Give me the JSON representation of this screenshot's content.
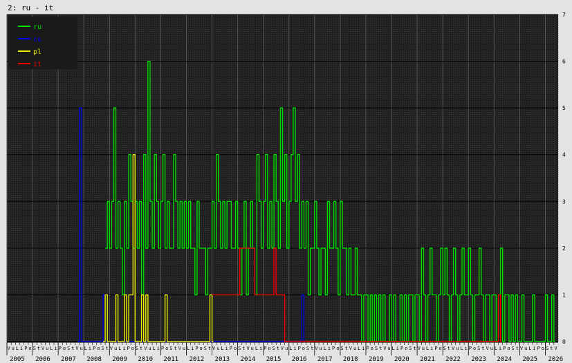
{
  "chart_data": {
    "type": "line",
    "title": "2: ru - it",
    "ylim": [
      0,
      7
    ],
    "y_ticks": [
      0,
      1,
      2,
      3,
      4,
      5,
      6,
      7
    ],
    "x_range": [
      "2005-01",
      "2026-07"
    ],
    "year_labels": [
      "2005",
      "2006",
      "2007",
      "2008",
      "2009",
      "2010",
      "2011",
      "2012",
      "2013",
      "2014",
      "2015",
      "2016",
      "2017",
      "2018",
      "2019",
      "2020",
      "2021",
      "2022",
      "2023",
      "2024",
      "2025",
      "2026"
    ],
    "month_labels": [
      "L",
      "i",
      "P",
      "o",
      "S",
      "t",
      "V",
      "u"
    ],
    "legend_position": "top-left",
    "background": "#202020",
    "grid": true,
    "series": [
      {
        "name": "ru",
        "color": "#00dd00",
        "points": [
          [
            "2008-11",
            2
          ],
          [
            "2008-12",
            3
          ],
          [
            "2009-01",
            2
          ],
          [
            "2009-02",
            3
          ],
          [
            "2009-03",
            5
          ],
          [
            "2009-04",
            2
          ],
          [
            "2009-05",
            3
          ],
          [
            "2009-06",
            2
          ],
          [
            "2009-07",
            1
          ],
          [
            "2009-08",
            3
          ],
          [
            "2009-09",
            2
          ],
          [
            "2009-10",
            4
          ],
          [
            "2009-11",
            3
          ],
          [
            "2009-12",
            2
          ],
          [
            "2010-01",
            3
          ],
          [
            "2010-02",
            2
          ],
          [
            "2010-03",
            3
          ],
          [
            "2010-04",
            1
          ],
          [
            "2010-05",
            4
          ],
          [
            "2010-06",
            2
          ],
          [
            "2010-07",
            6
          ],
          [
            "2010-08",
            3
          ],
          [
            "2010-09",
            2
          ],
          [
            "2010-10",
            4
          ],
          [
            "2010-11",
            3
          ],
          [
            "2010-12",
            2
          ],
          [
            "2011-01",
            3
          ],
          [
            "2011-02",
            4
          ],
          [
            "2011-03",
            2
          ],
          [
            "2011-04",
            3
          ],
          [
            "2011-05",
            2
          ],
          [
            "2011-06",
            2
          ],
          [
            "2011-07",
            4
          ],
          [
            "2011-08",
            3
          ],
          [
            "2011-09",
            2
          ],
          [
            "2011-10",
            3
          ],
          [
            "2011-11",
            2
          ],
          [
            "2011-12",
            3
          ],
          [
            "2012-01",
            2
          ],
          [
            "2012-02",
            3
          ],
          [
            "2012-03",
            2
          ],
          [
            "2012-04",
            2
          ],
          [
            "2012-05",
            1
          ],
          [
            "2012-06",
            3
          ],
          [
            "2012-07",
            2
          ],
          [
            "2012-08",
            2
          ],
          [
            "2012-09",
            2
          ],
          [
            "2012-10",
            1
          ],
          [
            "2012-11",
            2
          ],
          [
            "2012-12",
            2
          ],
          [
            "2013-01",
            3
          ],
          [
            "2013-02",
            2
          ],
          [
            "2013-03",
            4
          ],
          [
            "2013-04",
            3
          ],
          [
            "2013-05",
            2
          ],
          [
            "2013-06",
            3
          ],
          [
            "2013-07",
            2
          ],
          [
            "2013-08",
            3
          ],
          [
            "2013-09",
            3
          ],
          [
            "2013-10",
            2
          ],
          [
            "2013-11",
            2
          ],
          [
            "2013-12",
            3
          ],
          [
            "2014-01",
            2
          ],
          [
            "2014-02",
            1
          ],
          [
            "2014-03",
            2
          ],
          [
            "2014-04",
            3
          ],
          [
            "2014-05",
            1
          ],
          [
            "2014-06",
            2
          ],
          [
            "2014-07",
            3
          ],
          [
            "2014-08",
            2
          ],
          [
            "2014-09",
            1
          ],
          [
            "2014-10",
            4
          ],
          [
            "2014-11",
            3
          ],
          [
            "2014-12",
            2
          ],
          [
            "2015-01",
            3
          ],
          [
            "2015-02",
            4
          ],
          [
            "2015-03",
            2
          ],
          [
            "2015-04",
            3
          ],
          [
            "2015-05",
            2
          ],
          [
            "2015-06",
            4
          ],
          [
            "2015-07",
            3
          ],
          [
            "2015-08",
            2
          ],
          [
            "2015-09",
            5
          ],
          [
            "2015-10",
            3
          ],
          [
            "2015-11",
            4
          ],
          [
            "2015-12",
            2
          ],
          [
            "2016-01",
            3
          ],
          [
            "2016-02",
            4
          ],
          [
            "2016-03",
            5
          ],
          [
            "2016-04",
            3
          ],
          [
            "2016-05",
            4
          ],
          [
            "2016-06",
            2
          ],
          [
            "2016-07",
            3
          ],
          [
            "2016-08",
            2
          ],
          [
            "2016-09",
            3
          ],
          [
            "2016-10",
            1
          ],
          [
            "2016-11",
            2
          ],
          [
            "2016-12",
            2
          ],
          [
            "2017-01",
            3
          ],
          [
            "2017-02",
            2
          ],
          [
            "2017-03",
            1
          ],
          [
            "2017-04",
            2
          ],
          [
            "2017-05",
            2
          ],
          [
            "2017-06",
            1
          ],
          [
            "2017-07",
            3
          ],
          [
            "2017-08",
            2
          ],
          [
            "2017-09",
            2
          ],
          [
            "2017-10",
            3
          ],
          [
            "2017-11",
            2
          ],
          [
            "2017-12",
            1
          ],
          [
            "2018-01",
            3
          ],
          [
            "2018-02",
            2
          ],
          [
            "2018-03",
            2
          ],
          [
            "2018-04",
            1
          ],
          [
            "2018-05",
            2
          ],
          [
            "2018-06",
            1
          ],
          [
            "2018-07",
            1
          ],
          [
            "2018-08",
            2
          ],
          [
            "2018-09",
            1
          ],
          [
            "2018-10",
            1
          ],
          [
            "2018-11",
            0
          ],
          [
            "2018-12",
            1
          ],
          [
            "2019-01",
            1
          ],
          [
            "2019-02",
            0
          ],
          [
            "2019-03",
            1
          ],
          [
            "2019-04",
            0
          ],
          [
            "2019-05",
            1
          ],
          [
            "2019-06",
            0
          ],
          [
            "2019-07",
            1
          ],
          [
            "2019-08",
            0
          ],
          [
            "2019-09",
            1
          ],
          [
            "2019-10",
            0
          ],
          [
            "2019-11",
            0
          ],
          [
            "2019-12",
            1
          ],
          [
            "2020-01",
            0
          ],
          [
            "2020-02",
            1
          ],
          [
            "2020-03",
            0
          ],
          [
            "2020-04",
            0
          ],
          [
            "2020-05",
            1
          ],
          [
            "2020-06",
            0
          ],
          [
            "2020-07",
            1
          ],
          [
            "2020-08",
            0
          ],
          [
            "2020-09",
            1
          ],
          [
            "2020-10",
            1
          ],
          [
            "2020-11",
            0
          ],
          [
            "2020-12",
            1
          ],
          [
            "2021-01",
            1
          ],
          [
            "2021-02",
            0
          ],
          [
            "2021-03",
            2
          ],
          [
            "2021-04",
            1
          ],
          [
            "2021-05",
            0
          ],
          [
            "2021-06",
            1
          ],
          [
            "2021-07",
            2
          ],
          [
            "2021-08",
            1
          ],
          [
            "2021-09",
            1
          ],
          [
            "2021-10",
            0
          ],
          [
            "2021-11",
            1
          ],
          [
            "2021-12",
            2
          ],
          [
            "2022-01",
            1
          ],
          [
            "2022-02",
            2
          ],
          [
            "2022-03",
            1
          ],
          [
            "2022-04",
            0
          ],
          [
            "2022-05",
            1
          ],
          [
            "2022-06",
            2
          ],
          [
            "2022-07",
            1
          ],
          [
            "2022-08",
            0
          ],
          [
            "2022-09",
            1
          ],
          [
            "2022-10",
            2
          ],
          [
            "2022-11",
            1
          ],
          [
            "2022-12",
            1
          ],
          [
            "2023-01",
            2
          ],
          [
            "2023-02",
            1
          ],
          [
            "2023-03",
            0
          ],
          [
            "2023-04",
            1
          ],
          [
            "2023-05",
            1
          ],
          [
            "2023-06",
            2
          ],
          [
            "2023-07",
            1
          ],
          [
            "2023-08",
            0
          ],
          [
            "2023-09",
            1
          ],
          [
            "2023-10",
            1
          ],
          [
            "2023-11",
            0
          ],
          [
            "2023-12",
            1
          ],
          [
            "2024-01",
            1
          ],
          [
            "2024-02",
            0
          ],
          [
            "2024-03",
            1
          ],
          [
            "2024-04",
            2
          ],
          [
            "2024-05",
            0
          ],
          [
            "2024-06",
            1
          ],
          [
            "2024-07",
            1
          ],
          [
            "2024-08",
            0
          ],
          [
            "2024-09",
            1
          ],
          [
            "2024-10",
            0
          ],
          [
            "2024-11",
            1
          ],
          [
            "2024-12",
            0
          ],
          [
            "2025-01",
            0
          ],
          [
            "2025-02",
            1
          ],
          [
            "2025-03",
            0
          ],
          [
            "2025-04",
            0
          ],
          [
            "2025-05",
            0
          ],
          [
            "2025-06",
            0
          ],
          [
            "2025-07",
            1
          ],
          [
            "2025-08",
            0
          ],
          [
            "2025-09",
            0
          ],
          [
            "2025-10",
            0
          ],
          [
            "2025-11",
            0
          ],
          [
            "2025-12",
            0
          ],
          [
            "2026-01",
            1
          ],
          [
            "2026-02",
            0
          ],
          [
            "2026-03",
            0
          ],
          [
            "2026-04",
            1
          ],
          [
            "2026-05",
            0
          ]
        ]
      },
      {
        "name": "cs",
        "color": "#0000ee",
        "points": [
          [
            "2007-10",
            0
          ],
          [
            "2007-11",
            5
          ],
          [
            "2007-12",
            0
          ],
          [
            "2008-09",
            0
          ],
          [
            "2008-10",
            1
          ],
          [
            "2008-11",
            0
          ],
          [
            "2016-06",
            0
          ],
          [
            "2016-07",
            1
          ],
          [
            "2016-08",
            0
          ]
        ]
      },
      {
        "name": "pl",
        "color": "#eeee00",
        "points": [
          [
            "2008-10",
            0
          ],
          [
            "2008-11",
            1
          ],
          [
            "2008-12",
            0
          ],
          [
            "2009-03",
            0
          ],
          [
            "2009-04",
            1
          ],
          [
            "2009-05",
            0
          ],
          [
            "2009-07",
            0
          ],
          [
            "2009-08",
            1
          ],
          [
            "2009-09",
            0
          ],
          [
            "2009-10",
            1
          ],
          [
            "2009-11",
            1
          ],
          [
            "2009-12",
            4
          ],
          [
            "2010-01",
            0
          ],
          [
            "2010-03",
            0
          ],
          [
            "2010-04",
            1
          ],
          [
            "2010-05",
            0
          ],
          [
            "2010-06",
            1
          ],
          [
            "2010-07",
            0
          ],
          [
            "2011-02",
            0
          ],
          [
            "2011-03",
            1
          ],
          [
            "2011-04",
            0
          ],
          [
            "2012-11",
            0
          ],
          [
            "2012-12",
            1
          ],
          [
            "2013-01",
            0
          ]
        ]
      },
      {
        "name": "it",
        "color": "#ee0000",
        "points": [
          [
            "2013-01",
            1
          ],
          [
            "2013-04",
            1
          ],
          [
            "2013-07",
            1
          ],
          [
            "2014-01",
            1
          ],
          [
            "2014-02",
            2
          ],
          [
            "2014-08",
            2
          ],
          [
            "2014-09",
            1
          ],
          [
            "2015-02",
            1
          ],
          [
            "2015-04",
            1
          ],
          [
            "2015-06",
            2
          ],
          [
            "2015-07",
            1
          ],
          [
            "2015-09",
            1
          ],
          [
            "2015-11",
            0
          ],
          [
            "2016-06",
            0
          ],
          [
            "2024-02",
            0
          ],
          [
            "2024-03",
            1
          ],
          [
            "2024-04",
            0
          ]
        ]
      }
    ]
  }
}
